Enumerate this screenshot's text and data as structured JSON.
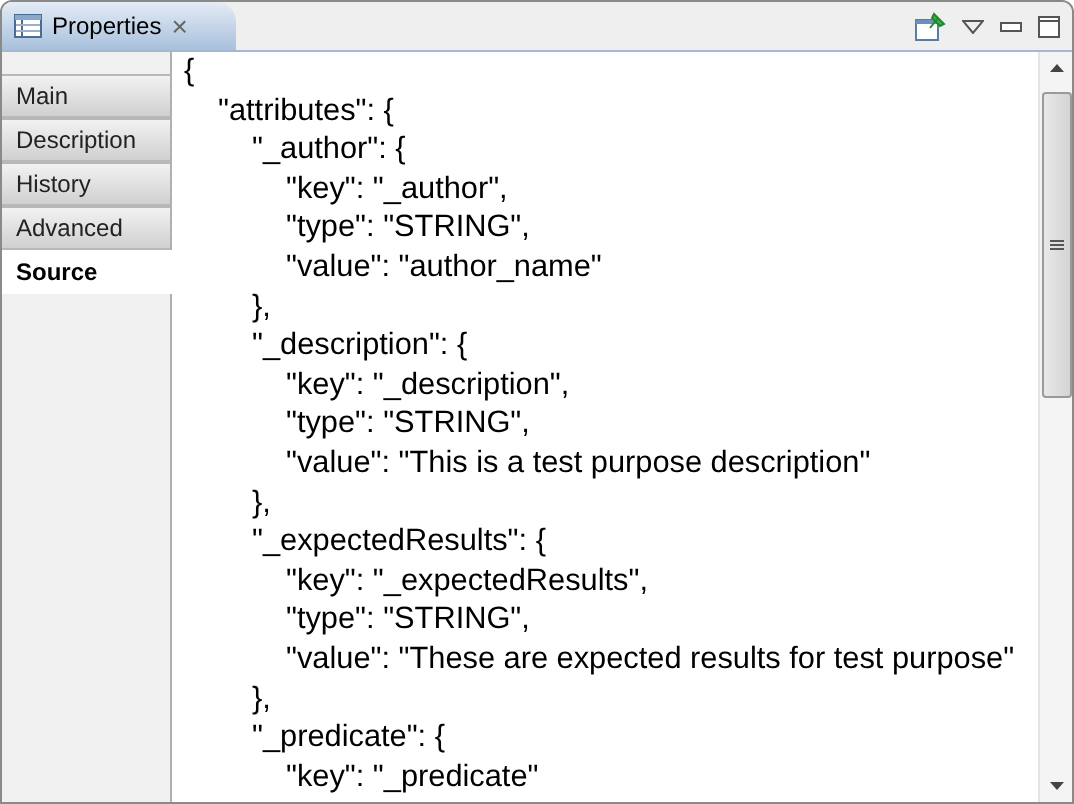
{
  "view_tab": {
    "title": "Properties",
    "close": "×"
  },
  "sections": [
    {
      "label": "Main",
      "selected": false
    },
    {
      "label": "Description",
      "selected": false
    },
    {
      "label": "History",
      "selected": false
    },
    {
      "label": "Advanced",
      "selected": false
    },
    {
      "label": "Source",
      "selected": true
    }
  ],
  "source_lines": [
    "{",
    "\t\"attributes\": {",
    "\t\t\"_author\": {",
    "\t\t\t\"key\": \"_author\",",
    "\t\t\t\"type\": \"STRING\",",
    "\t\t\t\"value\": \"author_name\"",
    "\t\t},",
    "\t\t\"_description\": {",
    "\t\t\t\"key\": \"_description\",",
    "\t\t\t\"type\": \"STRING\",",
    "\t\t\t\"value\": \"This is a test purpose description\"",
    "\t\t},",
    "\t\t\"_expectedResults\": {",
    "\t\t\t\"key\": \"_expectedResults\",",
    "\t\t\t\"type\": \"STRING\",",
    "\t\t\t\"value\": \"These are expected results for test purpose\"",
    "\t\t},",
    "\t\t\"_predicate\": {",
    "\t\t\t\"key\": \"_predicate\""
  ]
}
